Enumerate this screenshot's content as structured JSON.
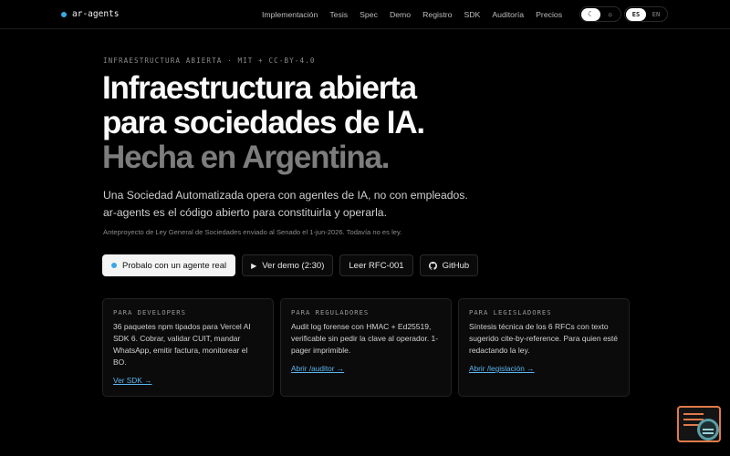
{
  "nav": {
    "brand": "ar-agents",
    "links": [
      "Implementación",
      "Tesis",
      "Spec",
      "Demo",
      "Registro",
      "SDK",
      "Auditoría",
      "Precios"
    ],
    "theme": {
      "dark_icon": "moon-icon",
      "light_icon": "sun-icon",
      "selected": "dark"
    },
    "lang": {
      "options": [
        "ES",
        "EN"
      ],
      "selected": "ES"
    }
  },
  "hero": {
    "eyebrow": "INFRAESTRUCTURA ABIERTA · MIT + CC-BY-4.0",
    "title_line1": "Infraestructura abierta",
    "title_line2": "para sociedades de IA.",
    "title_line3": "Hecha en Argentina.",
    "lead_line1": "Una Sociedad Automatizada opera con agentes de IA, no con empleados.",
    "lead_line2": "ar-agents es el código abierto para constituirla y operarla.",
    "note": "Anteproyecto de Ley General de Sociedades enviado al Senado el 1-jun-2026. Todavía no es ley."
  },
  "cta": {
    "primary": "Probalo con un agente real",
    "demo": "Ver demo (2:30)",
    "rfc": "Leer RFC-001",
    "github": "GitHub"
  },
  "cards": [
    {
      "title": "PARA DEVELOPERS",
      "body": "36 paquetes npm tipados para Vercel AI SDK 6. Cobrar, validar CUIT, mandar WhatsApp, emitir factura, monitorear el BO.",
      "link": "Ver SDK →"
    },
    {
      "title": "PARA REGULADORES",
      "body": "Audit log forense con HMAC + Ed25519, verificable sin pedir la clave al operador. 1-pager imprimible.",
      "link": "Abrir /auditor →"
    },
    {
      "title": "PARA LEGISLADORES",
      "body": "Síntesis técnica de los 6 RFCs con texto sugerido cite-by-reference. Para quien esté redactando la ley.",
      "link": "Abrir /legislación →"
    }
  ],
  "colors": {
    "accent": "#3aa7e6",
    "link": "#5cb6f0",
    "background": "#000000",
    "widget": "#e07a4a"
  }
}
